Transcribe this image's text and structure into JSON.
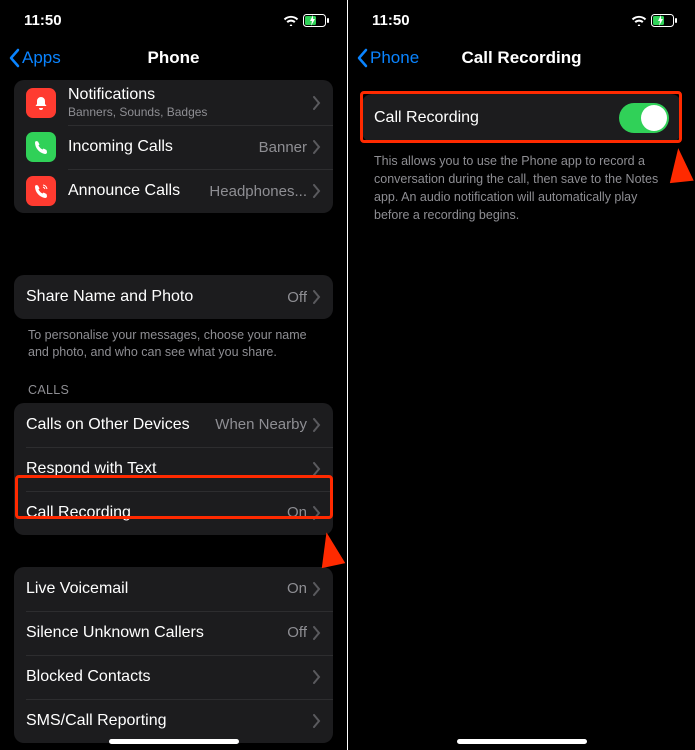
{
  "left": {
    "time": "11:50",
    "back_label": "Apps",
    "title": "Phone",
    "notifications": {
      "title": "Notifications",
      "sub": "Banners, Sounds, Badges"
    },
    "incoming": {
      "title": "Incoming Calls",
      "value": "Banner"
    },
    "announce": {
      "title": "Announce Calls",
      "value": "Headphones..."
    },
    "share": {
      "title": "Share Name and Photo",
      "value": "Off"
    },
    "share_footer": "To personalise your messages, choose your name and photo, and who can see what you share.",
    "calls_header": "CALLS",
    "calls_other": {
      "title": "Calls on Other Devices",
      "value": "When Nearby"
    },
    "respond": {
      "title": "Respond with Text"
    },
    "call_rec": {
      "title": "Call Recording",
      "value": "On"
    },
    "voicemail": {
      "title": "Live Voicemail",
      "value": "On"
    },
    "silence": {
      "title": "Silence Unknown Callers",
      "value": "Off"
    },
    "blocked": {
      "title": "Blocked Contacts"
    },
    "sms": {
      "title": "SMS/Call Reporting"
    }
  },
  "right": {
    "time": "11:50",
    "back_label": "Phone",
    "title": "Call Recording",
    "row_label": "Call Recording",
    "desc": "This allows you to use the Phone app to record a conversation during the call, then save to the Notes app. An audio notification will automatically play before a recording begins."
  }
}
